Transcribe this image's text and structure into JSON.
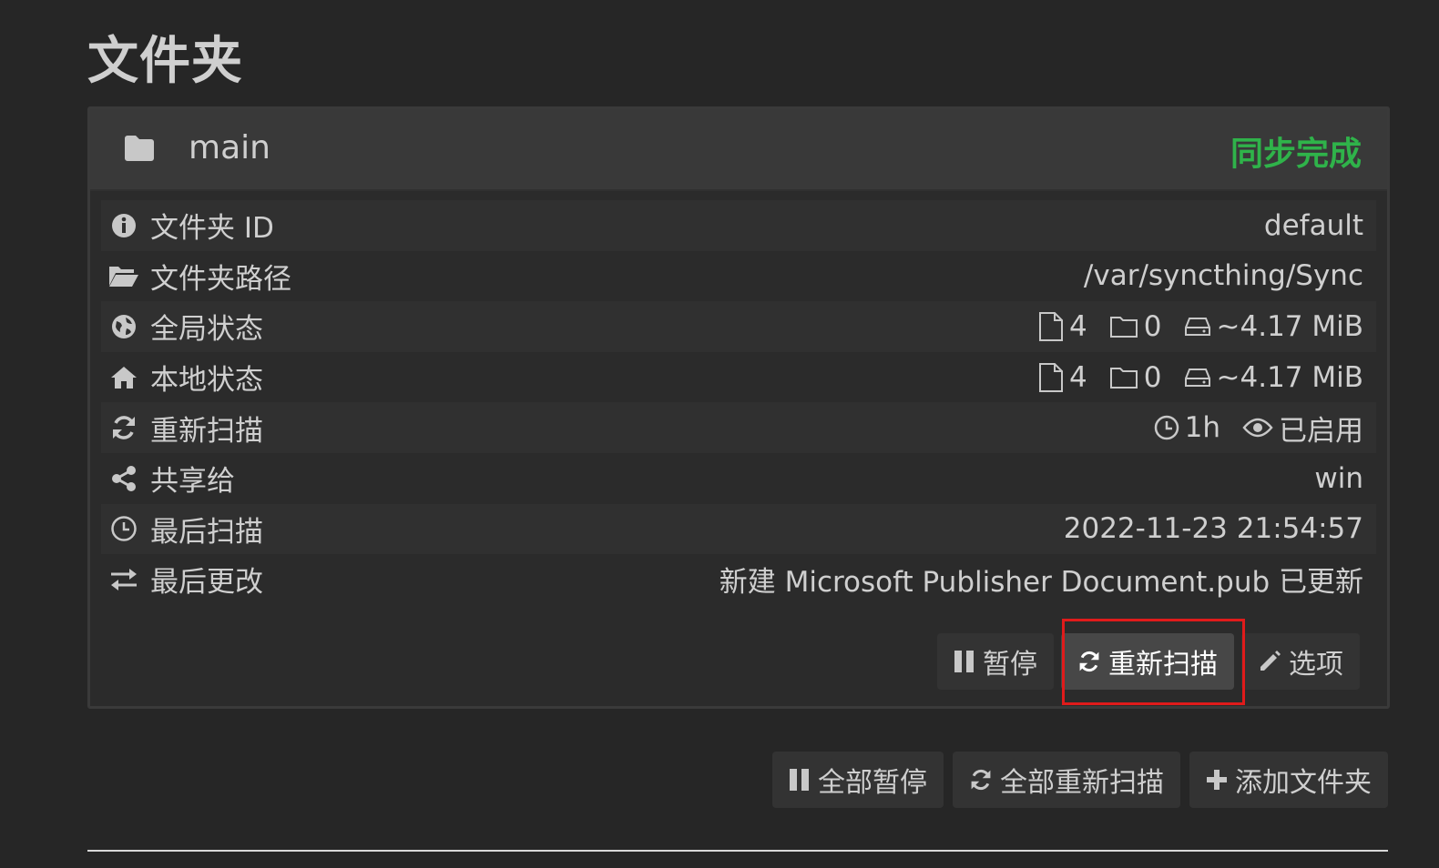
{
  "page": {
    "title": "文件夹"
  },
  "folder": {
    "name": "main",
    "status": "同步完成",
    "status_color": "#2fb34a",
    "rows": [
      {
        "icon": "info-icon",
        "label": "文件夹 ID",
        "value": "default"
      },
      {
        "icon": "folder-open-icon",
        "label": "文件夹路径",
        "value": "/var/syncthing/Sync"
      },
      {
        "icon": "globe-icon",
        "label": "全局状态",
        "files": "4",
        "dirs": "0",
        "size": "~4.17 MiB"
      },
      {
        "icon": "home-icon",
        "label": "本地状态",
        "files": "4",
        "dirs": "0",
        "size": "~4.17 MiB"
      },
      {
        "icon": "refresh-icon",
        "label": "重新扫描",
        "interval": "1h",
        "watch": "已启用"
      },
      {
        "icon": "share-icon",
        "label": "共享给",
        "value": "win"
      },
      {
        "icon": "clock-icon",
        "label": "最后扫描",
        "value": "2022-11-23 21:54:57"
      },
      {
        "icon": "exchange-icon",
        "label": "最后更改",
        "value": "新建 Microsoft Publisher Document.pub 已更新"
      }
    ],
    "actions": {
      "pause": "暂停",
      "rescan": "重新扫描",
      "options": "选项"
    }
  },
  "global_actions": {
    "pause_all": "全部暂停",
    "rescan_all": "全部重新扫描",
    "add_folder": "添加文件夹"
  },
  "highlight_color": "#e01b1b"
}
